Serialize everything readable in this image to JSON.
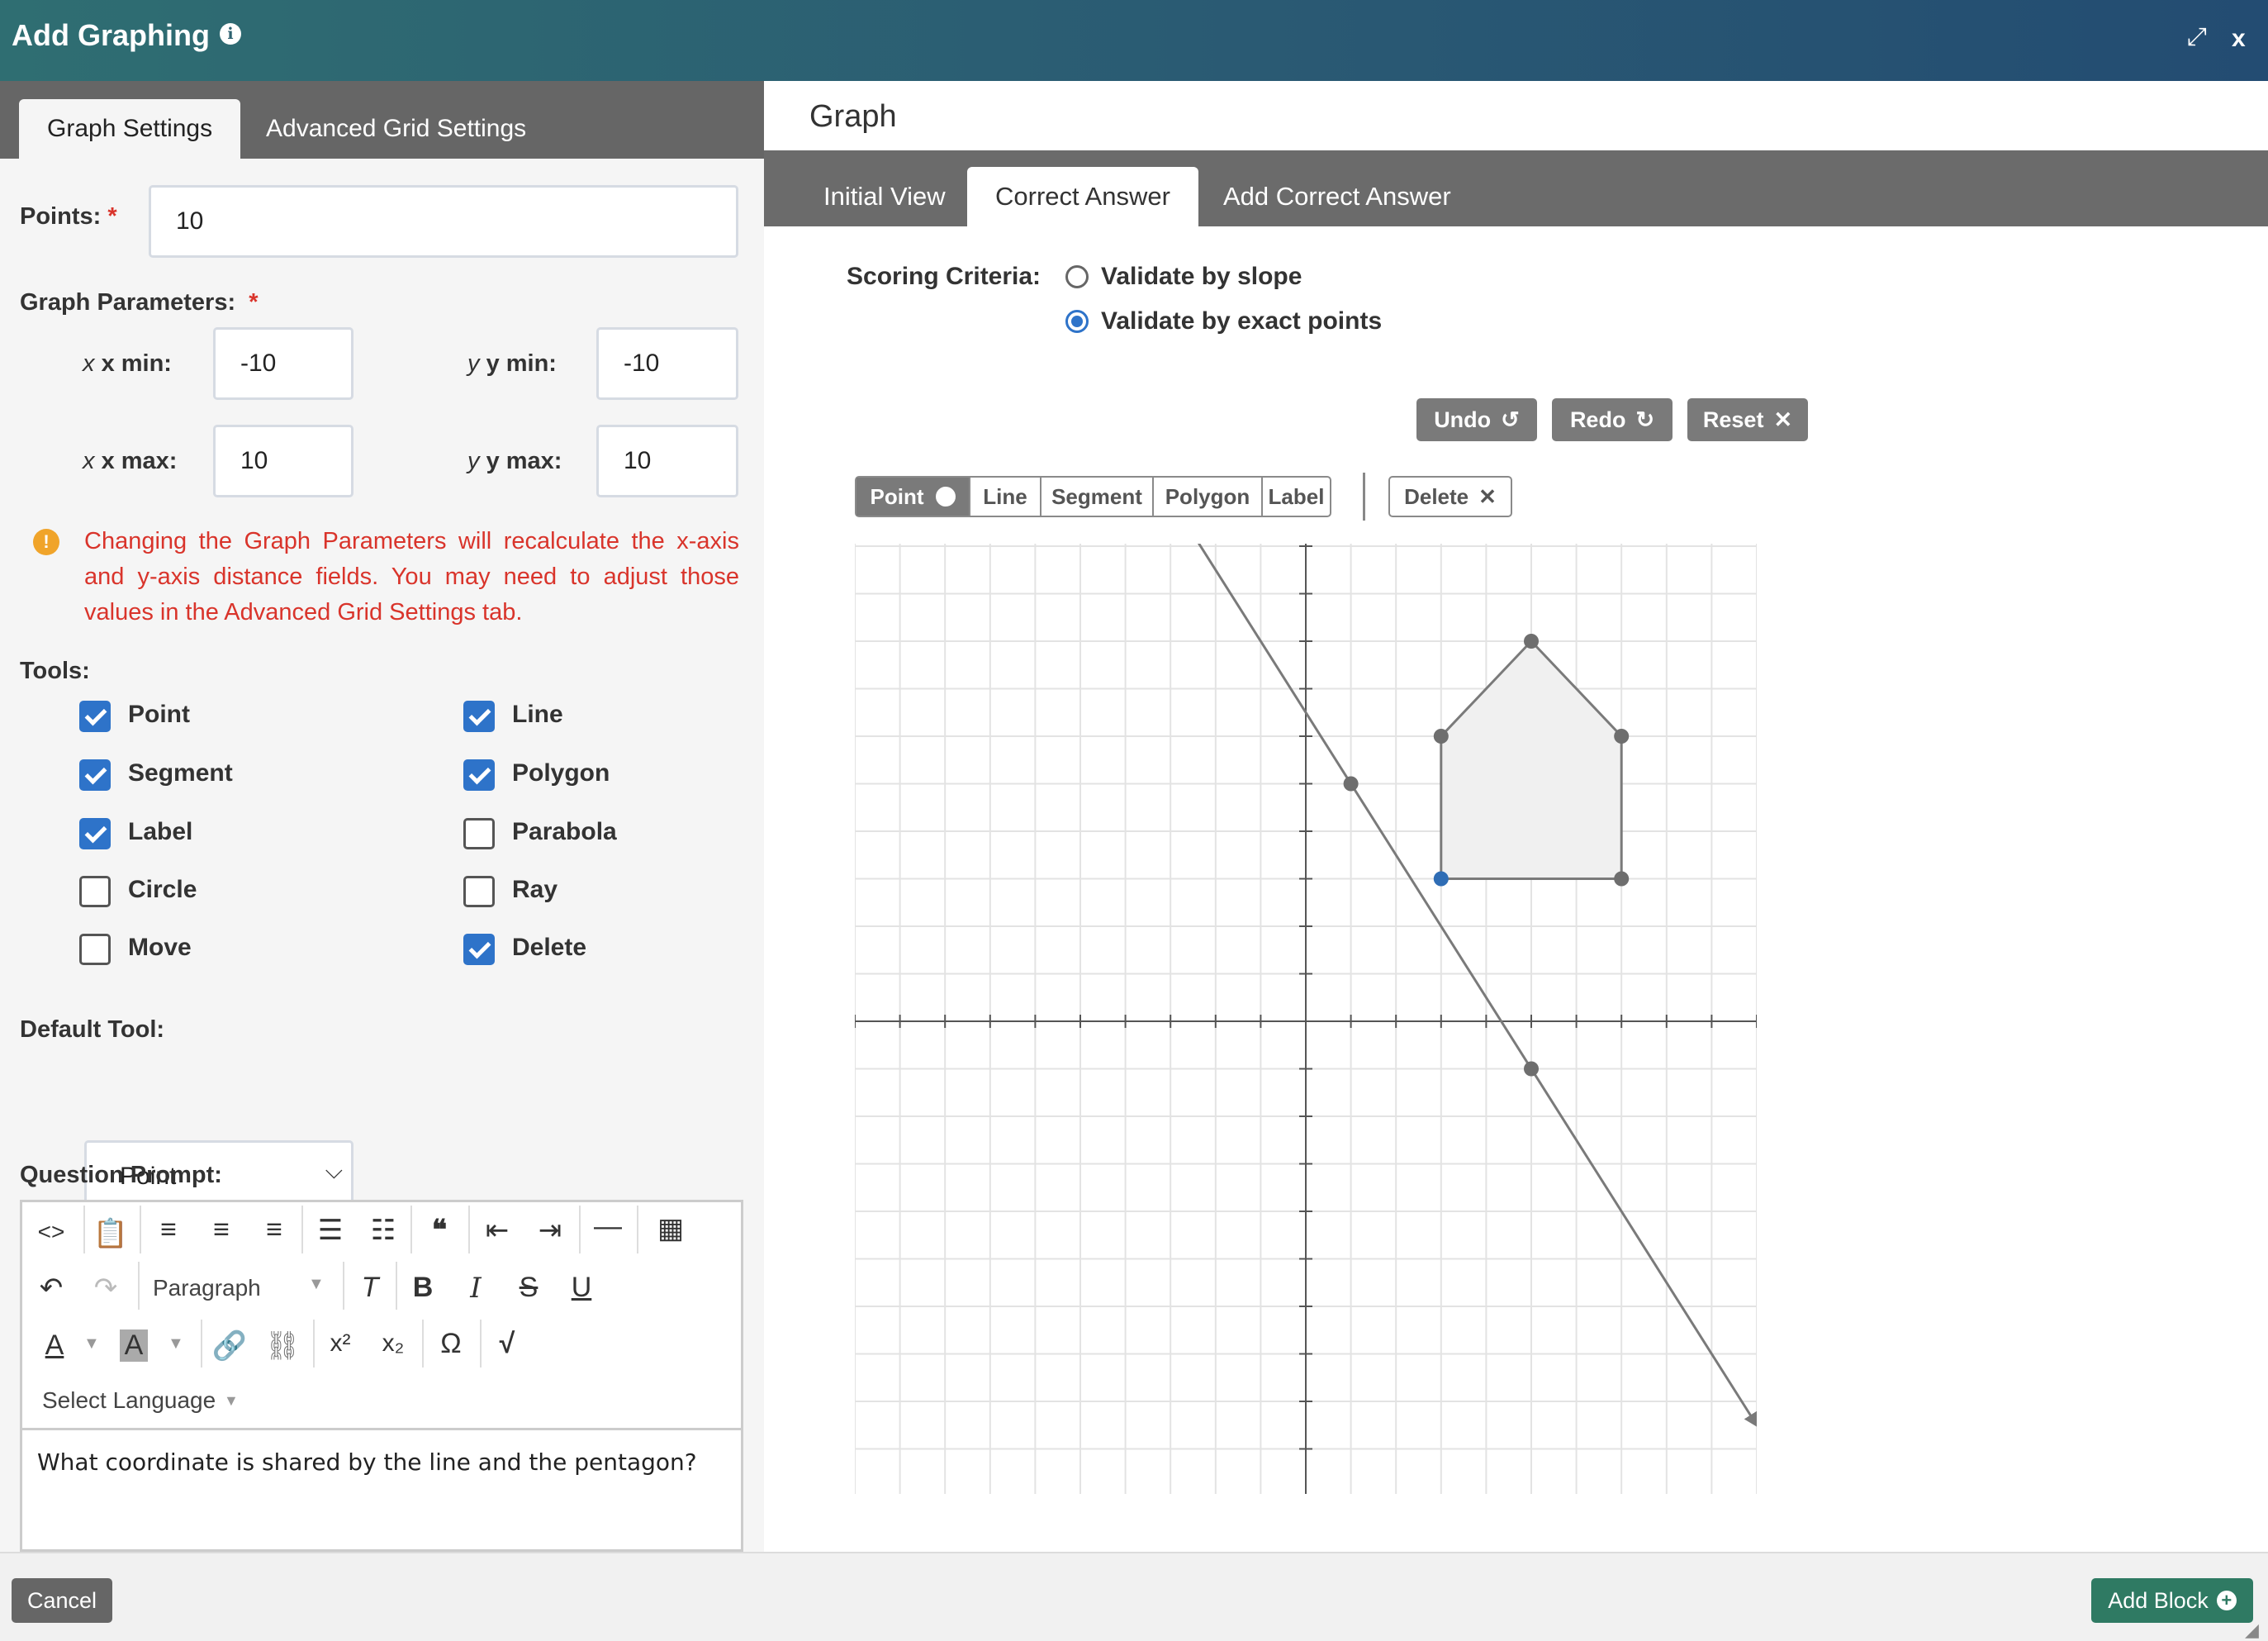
{
  "header": {
    "title": "Add Graphing",
    "expand_glyph": "⤢",
    "close_glyph": "x"
  },
  "left_tabs": [
    "Graph Settings",
    "Advanced Grid Settings"
  ],
  "points": {
    "label": "Points:",
    "value": "10"
  },
  "graph_parameters": {
    "label": "Graph Parameters:",
    "x_min_label": "x min:",
    "x_min": "-10",
    "y_min_label": "y min:",
    "y_min": "-10",
    "x_max_label": "x max:",
    "x_max": "10",
    "y_max_label": "y max:",
    "y_max": "10"
  },
  "warning": "Changing the Graph Parameters will recalculate the x-axis and y-axis distance fields. You may need to adjust those values in the Advanced Grid Settings tab.",
  "tools": {
    "label": "Tools:",
    "items": [
      {
        "label": "Point",
        "checked": true
      },
      {
        "label": "Line",
        "checked": true
      },
      {
        "label": "Segment",
        "checked": true
      },
      {
        "label": "Polygon",
        "checked": true
      },
      {
        "label": "Label",
        "checked": true
      },
      {
        "label": "Parabola",
        "checked": false
      },
      {
        "label": "Circle",
        "checked": false
      },
      {
        "label": "Ray",
        "checked": false
      },
      {
        "label": "Move",
        "checked": false
      },
      {
        "label": "Delete",
        "checked": true
      }
    ]
  },
  "default_tool": {
    "label": "Default Tool:",
    "value": "Point"
  },
  "question_prompt": {
    "label": "Question Prompt:",
    "paragraph_format": "Paragraph",
    "select_language": "Select Language",
    "content": "What coordinate is shared by the line and the pentagon?"
  },
  "right": {
    "title": "Graph",
    "tabs": [
      "Initial View",
      "Correct Answer",
      "Add Correct Answer"
    ],
    "scoring_label": "Scoring Criteria:",
    "scoring_options": [
      {
        "label": "Validate by slope",
        "selected": false
      },
      {
        "label": "Validate by exact points",
        "selected": true
      }
    ],
    "undo": "Undo",
    "redo": "Redo",
    "reset": "Reset",
    "tool_buttons": [
      "Point",
      "Line",
      "Segment",
      "Polygon",
      "Label"
    ],
    "delete": "Delete"
  },
  "graph": {
    "xmin": -10,
    "xmax": 10,
    "ymin": -10,
    "ymax": 10,
    "line": {
      "through": [
        [
          1,
          5
        ],
        [
          5,
          -1
        ]
      ]
    },
    "line_points": [
      [
        1,
        5
      ],
      [
        5,
        -1
      ]
    ],
    "pentagon": [
      [
        3,
        3
      ],
      [
        5,
        8
      ],
      [
        7,
        6
      ],
      [
        7,
        3
      ],
      [
        3,
        6
      ]
    ],
    "polygon_order": [
      [
        3,
        3
      ],
      [
        3,
        6
      ],
      [
        5,
        8
      ],
      [
        7,
        6
      ],
      [
        7,
        3
      ]
    ],
    "shared_point": [
      3,
      3
    ],
    "colors": {
      "line": "#7a7a7a",
      "point": "#6e6e6e",
      "shared_point": "#2f6db5",
      "polygon_fill": "#f0f0f0",
      "grid": "#e3e3e3",
      "axis": "#555555"
    }
  },
  "footer": {
    "cancel": "Cancel",
    "add_block": "Add Block"
  }
}
